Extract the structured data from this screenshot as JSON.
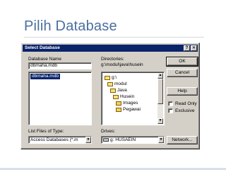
{
  "slide": {
    "title": "Pilih Database"
  },
  "dialog": {
    "title": "Select Database",
    "title_buttons": {
      "help": "?",
      "close": "×"
    },
    "database_name": {
      "label": "Database Name",
      "value": "dbmaha.mdb"
    },
    "file_list": {
      "items": [
        "dbmaha.mdb"
      ]
    },
    "directories": {
      "label": "Directories:",
      "path": "g:\\modul\\java\\husein",
      "items": [
        "g:\\",
        "modul",
        "Java",
        "Husein",
        "Images",
        "Pegawai"
      ]
    },
    "list_files_of_type": {
      "label": "List Files of Type:",
      "value": "Access Databases (*.m"
    },
    "drives": {
      "label": "Drives:",
      "value": "g: HUSAEIN"
    },
    "buttons": {
      "ok": "OK",
      "cancel": "Cancel",
      "help": "Help",
      "network": "Network..."
    },
    "checkboxes": {
      "read_only": "Read Only",
      "exclusive": "Exclusive"
    },
    "scroll": {
      "up": "▲",
      "down": "▼"
    },
    "combo_arrow": "▼"
  }
}
